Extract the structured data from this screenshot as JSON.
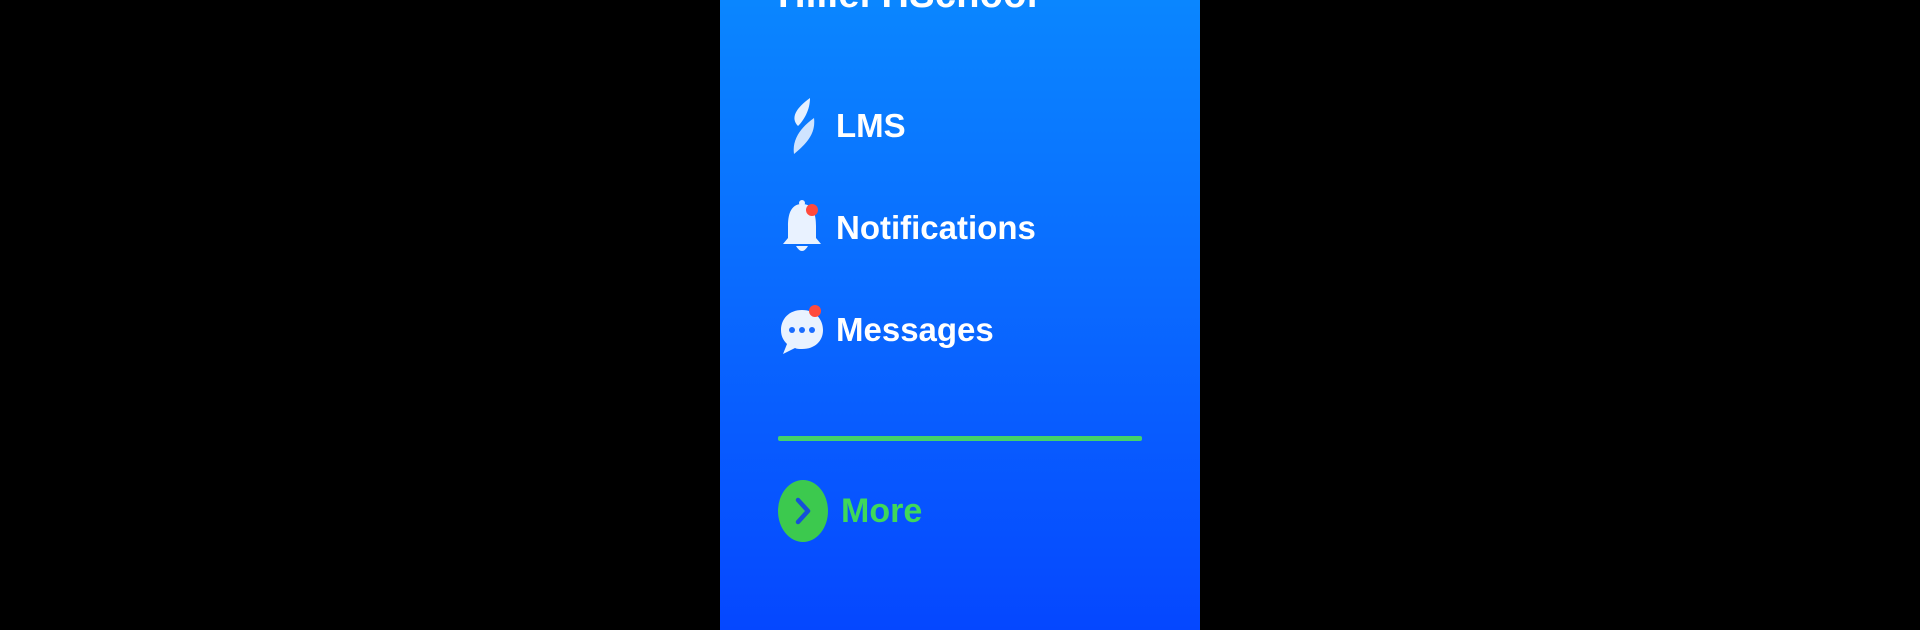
{
  "app": {
    "school_name": "Hillel HSchool"
  },
  "menu": {
    "items": [
      {
        "id": "lms",
        "label": "LMS",
        "icon": "lms-logo-icon"
      },
      {
        "id": "notifications",
        "label": "Notifications",
        "icon": "bell-icon",
        "has_badge": true
      },
      {
        "id": "messages",
        "label": "Messages",
        "icon": "chat-bubble-icon",
        "has_badge": true
      }
    ],
    "more_label": "More",
    "more_icon": "chevron-right-icon"
  },
  "colors": {
    "panel_top": "#0a86ff",
    "panel_bottom": "#0547ff",
    "accent_green": "#3cc94e",
    "badge_red": "#ff4a3d",
    "text": "#ffffff"
  }
}
